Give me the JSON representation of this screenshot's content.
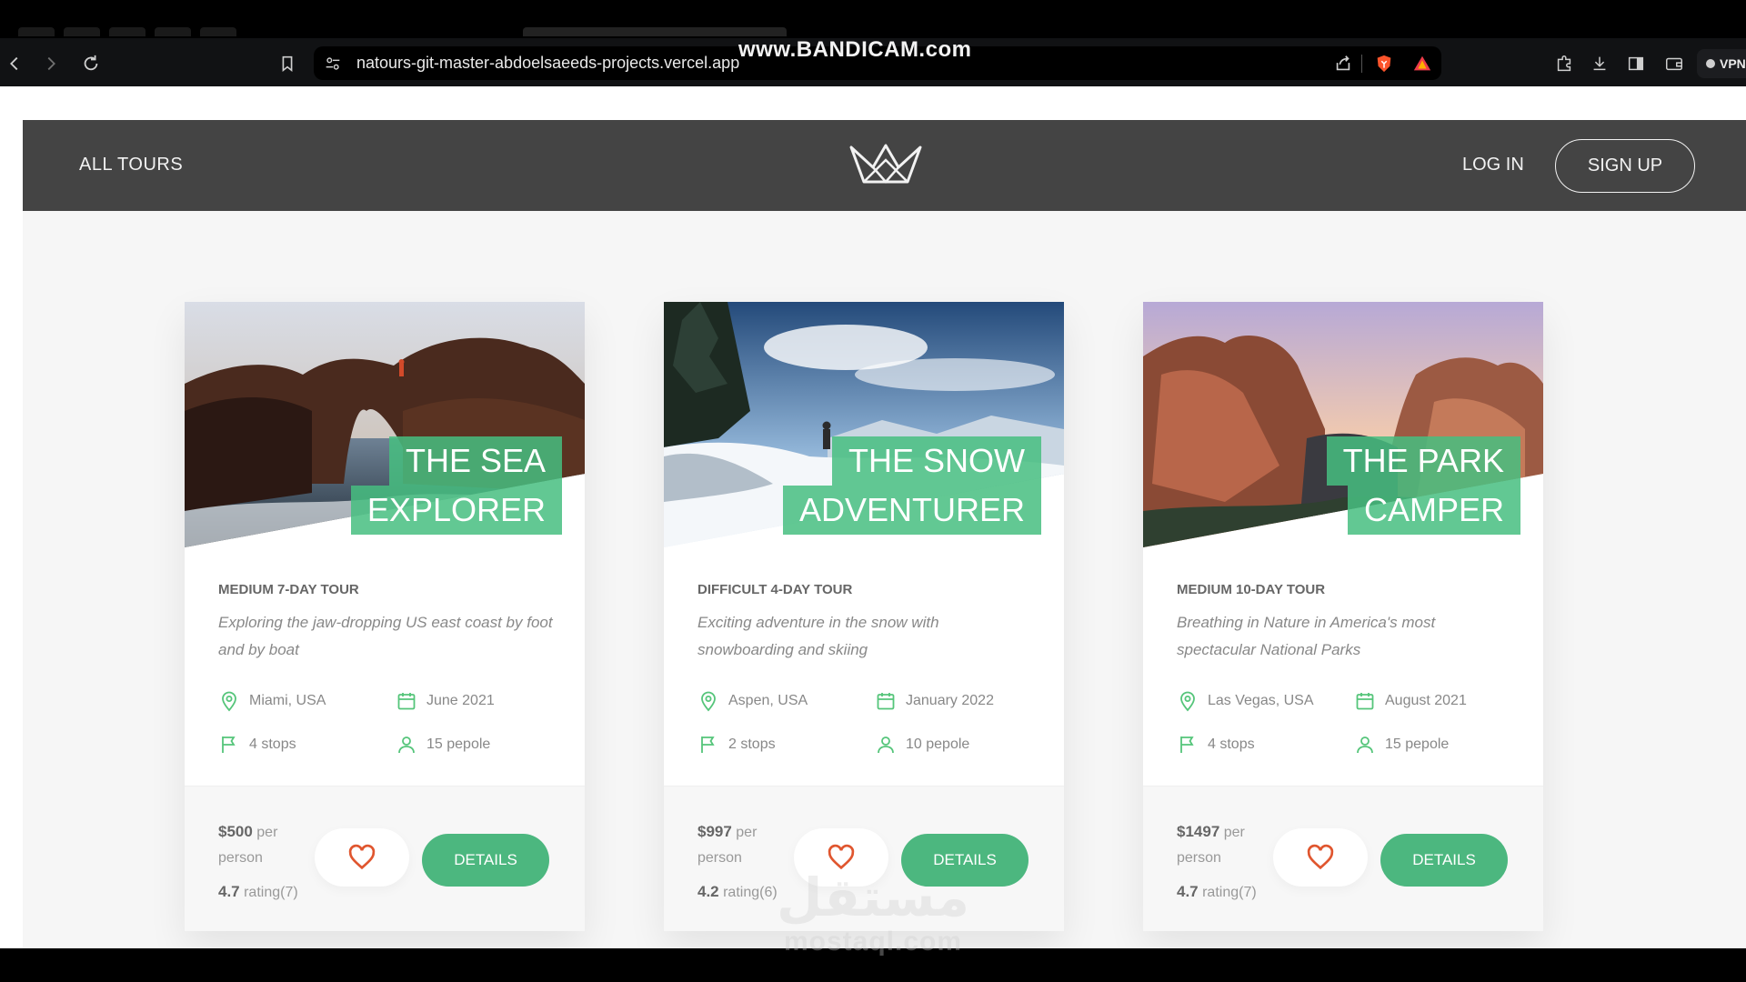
{
  "browser": {
    "url": "natours-git-master-abdoelsaeeds-projects.vercel.app",
    "watermark": "www.BANDICAM.com",
    "vpn_label": "VPN",
    "icons": [
      "back-icon",
      "forward-icon",
      "reload-icon",
      "bookmark-icon",
      "site-settings-icon",
      "share-icon",
      "brave-shield-icon",
      "brave-rewards-icon",
      "extensions-icon",
      "download-icon",
      "sidebar-icon",
      "wallet-icon"
    ]
  },
  "header": {
    "all_tours": "All tours",
    "login": "Log in",
    "signup": "Sign up",
    "logo_icon": "crown-logo-icon"
  },
  "colors": {
    "accent": "#55c57a",
    "header_bg": "#444444",
    "heart": "#e0562f"
  },
  "tours": [
    {
      "title_lines": [
        "The Sea",
        "Explorer"
      ],
      "subtitle": "Medium 7-day tour",
      "description": "Exploring the jaw-dropping US east coast by foot and by boat",
      "location": "Miami, USA",
      "date": "June 2021",
      "stops": "4 stops",
      "people": "15 pepole",
      "price": "$500",
      "price_unit": "per person",
      "rating": "4.7",
      "rating_label": "rating(7)",
      "details": "Details"
    },
    {
      "title_lines": [
        "The Snow",
        "Adventurer"
      ],
      "subtitle": "Difficult 4-day tour",
      "description": "Exciting adventure in the snow with snowboarding and skiing",
      "location": "Aspen, USA",
      "date": "January 2022",
      "stops": "2 stops",
      "people": "10 pepole",
      "price": "$997",
      "price_unit": "per person",
      "rating": "4.2",
      "rating_label": "rating(6)",
      "details": "Details"
    },
    {
      "title_lines": [
        "The Park",
        "Camper"
      ],
      "subtitle": "Medium 10-day tour",
      "description": "Breathing in Nature in America's most spectacular National Parks",
      "location": "Las Vegas, USA",
      "date": "August 2021",
      "stops": "4 stops",
      "people": "15 pepole",
      "price": "$1497",
      "price_unit": "per person",
      "rating": "4.7",
      "rating_label": "rating(7)",
      "details": "Details"
    }
  ],
  "overlay": {
    "mostaql_ar": "مستقل",
    "mostaql_en": "mostaql.com"
  }
}
